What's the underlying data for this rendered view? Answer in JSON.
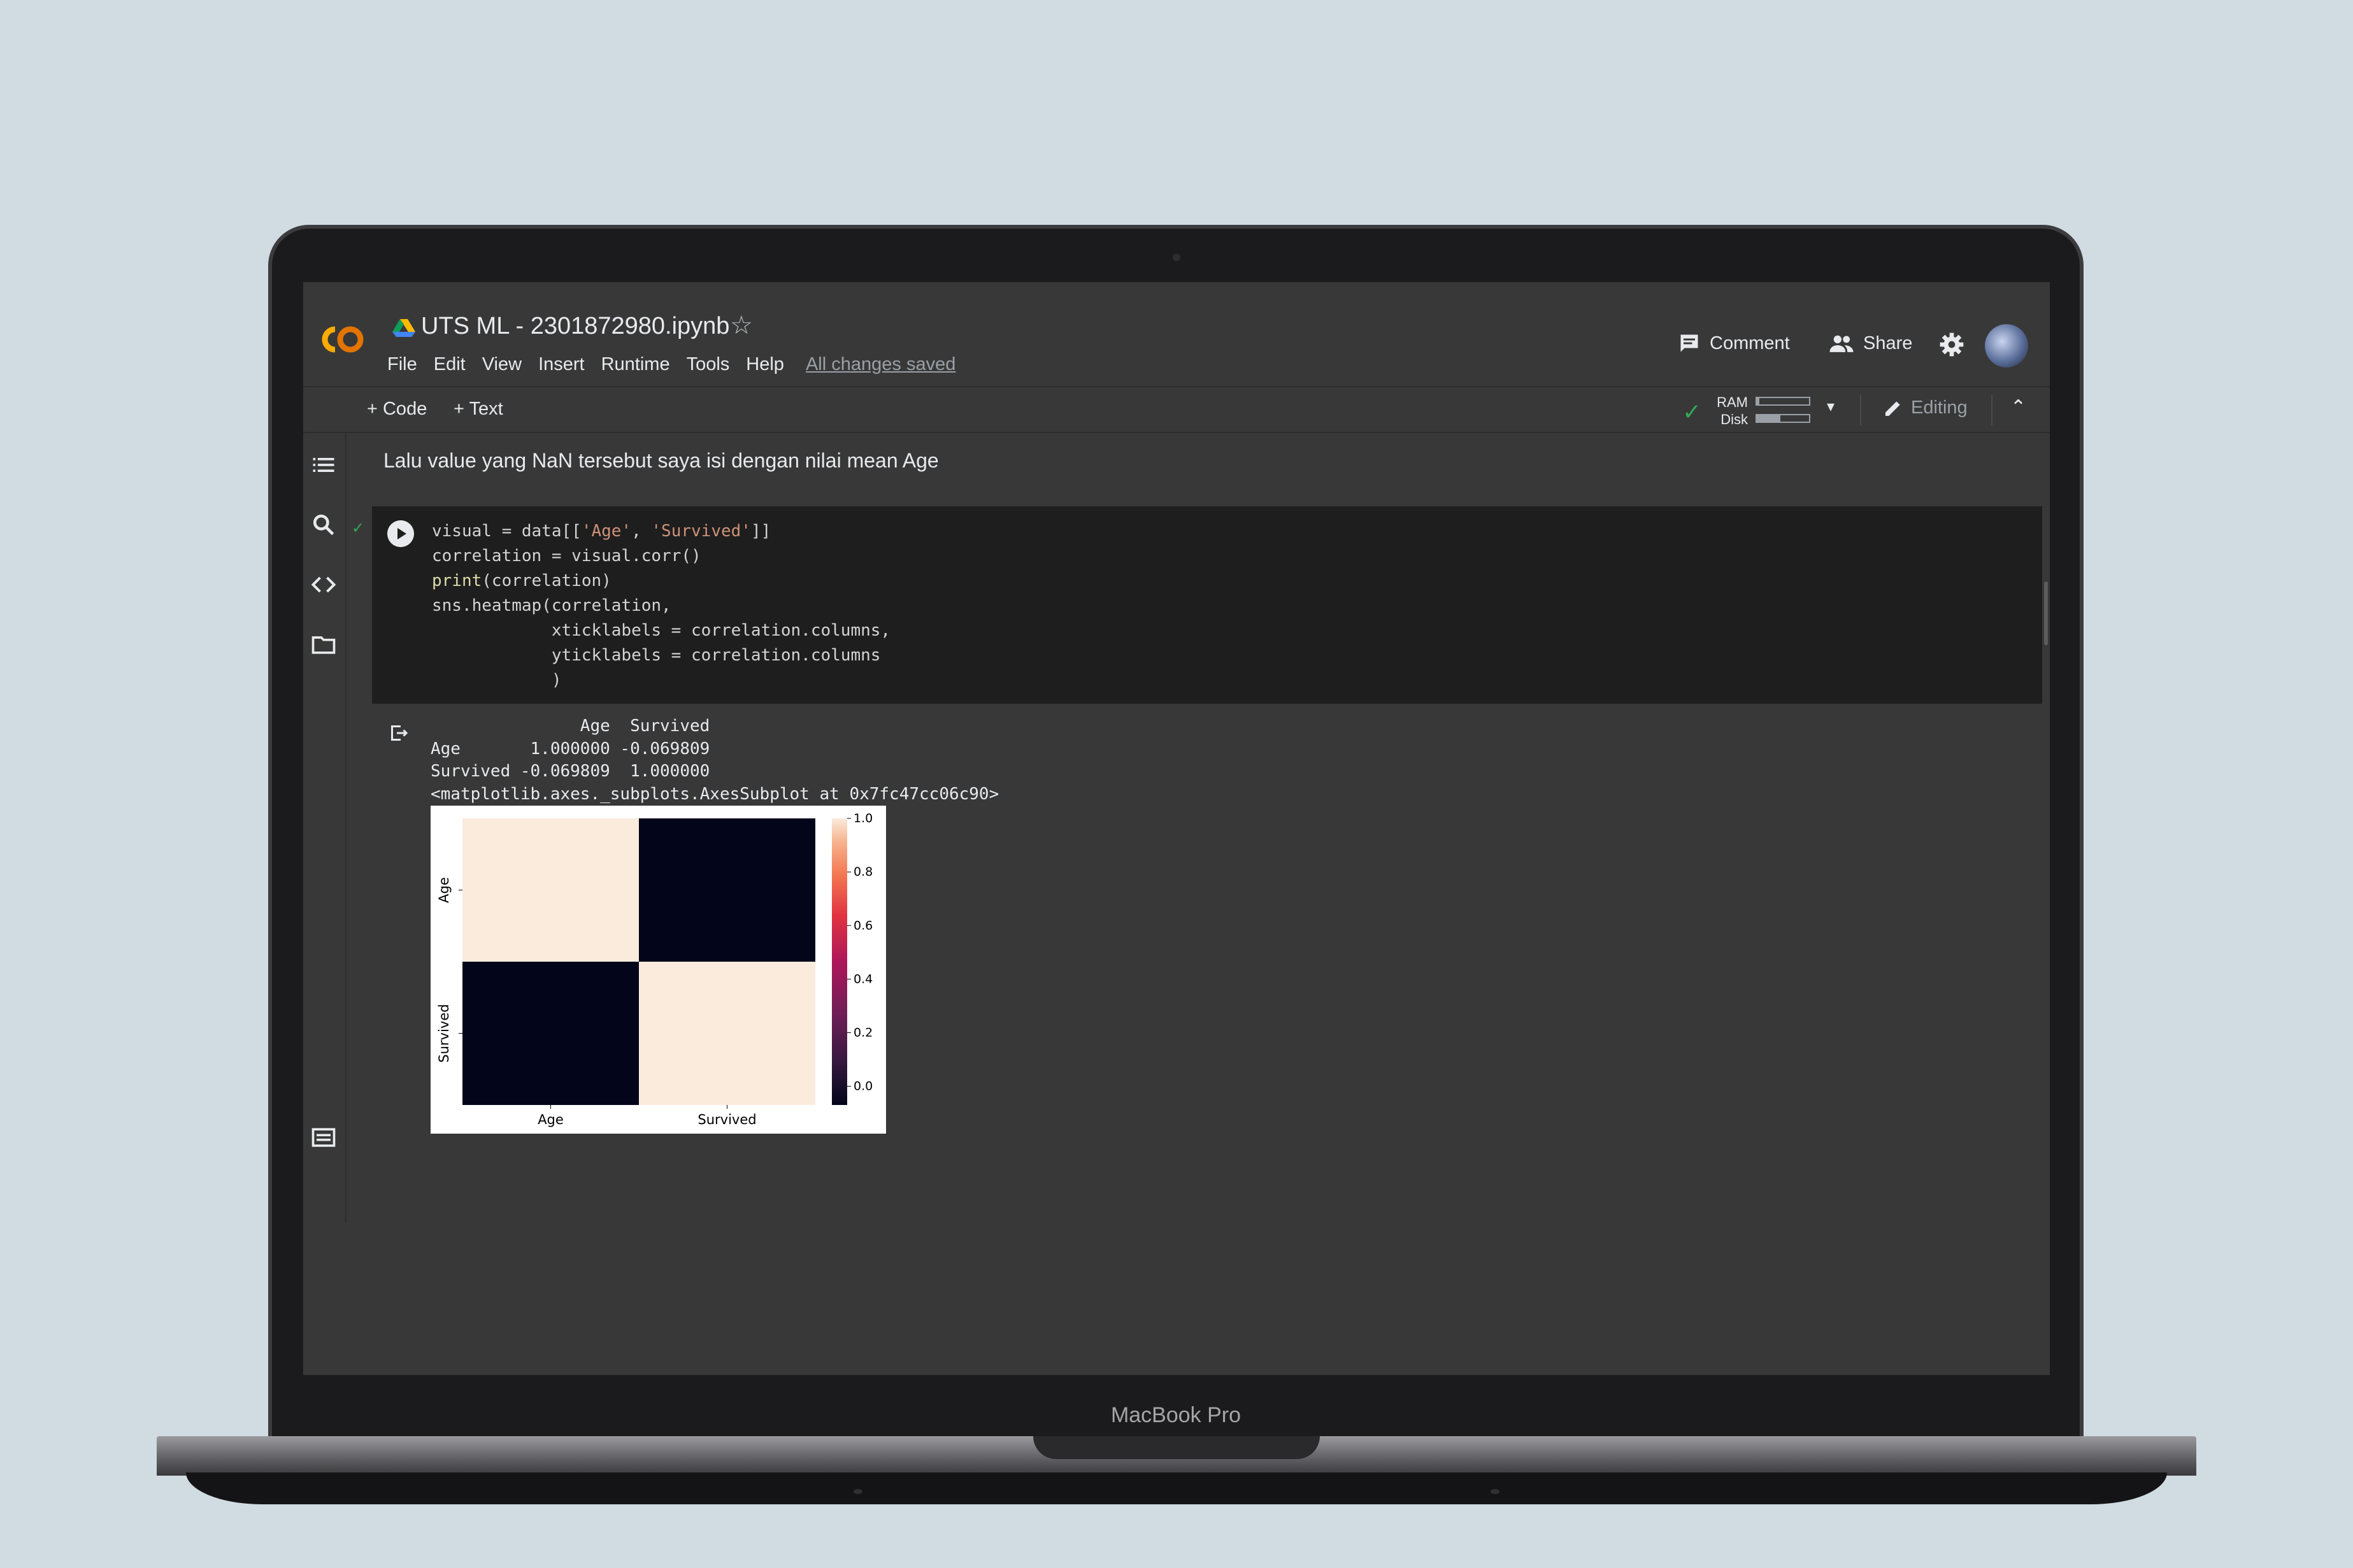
{
  "device": {
    "label": "MacBook Pro"
  },
  "header": {
    "title": "UTS ML - 2301872980.ipynb",
    "menu": [
      "File",
      "Edit",
      "View",
      "Insert",
      "Runtime",
      "Tools",
      "Help"
    ],
    "save_status": "All changes saved",
    "comment_label": "Comment",
    "share_label": "Share"
  },
  "toolbar": {
    "add_code": "+ Code",
    "add_text": "+ Text",
    "ram_label": "RAM",
    "disk_label": "Disk",
    "ram_usage": 0.05,
    "disk_usage": 0.45,
    "editing_label": "Editing"
  },
  "notebook": {
    "markdown_text": "Lalu value yang NaN tersebut saya isi dengan nilai mean Age",
    "code_lines": [
      "visual = data[['Age', 'Survived']]",
      "correlation = visual.corr()",
      "print(correlation)",
      "sns.heatmap(correlation,",
      "            xticklabels = correlation.columns,",
      "            yticklabels = correlation.columns",
      "            )"
    ],
    "output_lines": [
      "               Age  Survived",
      "Age       1.000000 -0.069809",
      "Survived -0.069809  1.000000",
      "<matplotlib.axes._subplots.AxesSubplot at 0x7fc47cc06c90>"
    ]
  },
  "chart_data": {
    "type": "heatmap",
    "x_labels": [
      "Age",
      "Survived"
    ],
    "y_labels": [
      "Age",
      "Survived"
    ],
    "values": [
      [
        1.0,
        -0.069809
      ],
      [
        -0.069809,
        1.0
      ]
    ],
    "colorbar_ticks": [
      "0.0",
      "0.2",
      "0.4",
      "0.6",
      "0.8",
      "1.0"
    ],
    "colorbar_range": [
      -0.069809,
      1.0
    ],
    "colormap": "rocket",
    "colors": {
      "high": "#faebdd",
      "low": "#03051a"
    }
  }
}
